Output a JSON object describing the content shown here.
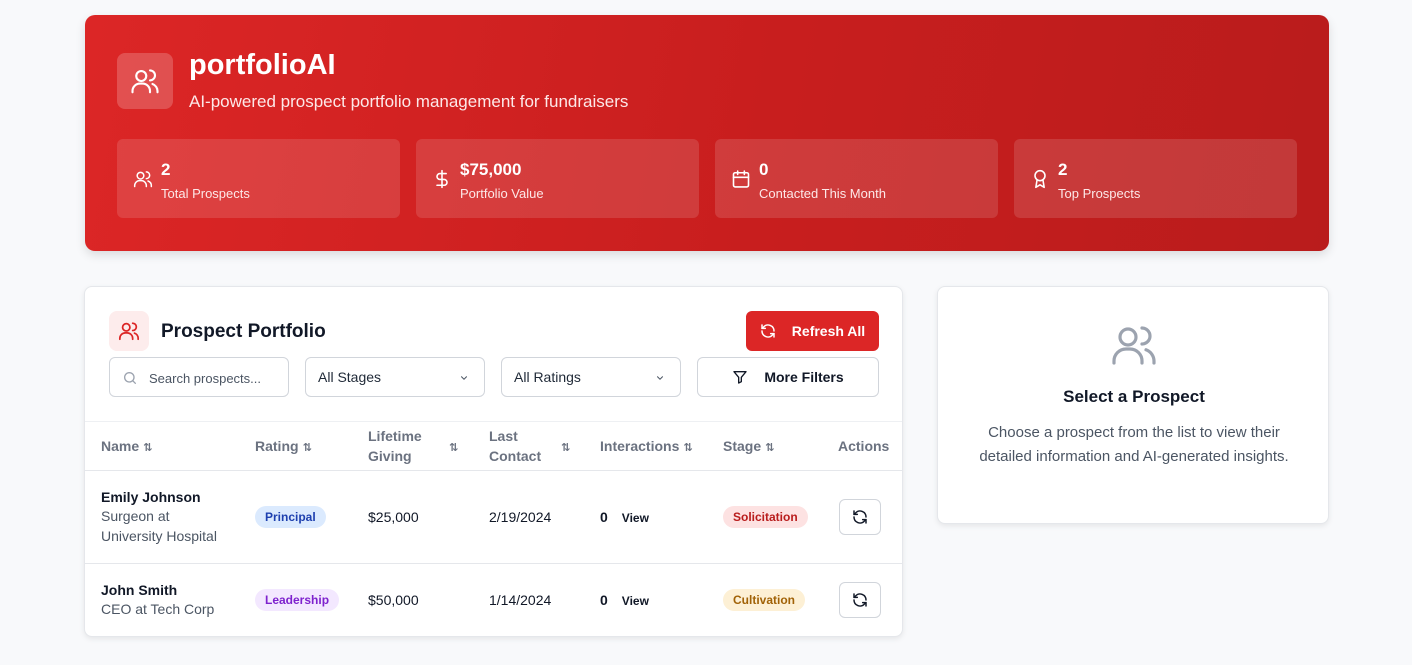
{
  "header": {
    "title": "portfolioAI",
    "subtitle": "AI-powered prospect portfolio management for fundraisers"
  },
  "stats": [
    {
      "value": "2",
      "label": "Total Prospects",
      "icon": "users-icon"
    },
    {
      "value": "$75,000",
      "label": "Portfolio Value",
      "icon": "dollar-icon"
    },
    {
      "value": "0",
      "label": "Contacted This Month",
      "icon": "calendar-icon"
    },
    {
      "value": "2",
      "label": "Top Prospects",
      "icon": "award-icon"
    }
  ],
  "portfolio": {
    "title": "Prospect Portfolio",
    "refresh_label": "Refresh All",
    "search_placeholder": "Search prospects...",
    "stage_filter": "All Stages",
    "rating_filter": "All Ratings",
    "more_filters_label": "More Filters",
    "columns": {
      "name": "Name",
      "rating": "Rating",
      "lifetime_giving": "Lifetime Giving",
      "last_contact": "Last Contact",
      "interactions": "Interactions",
      "stage": "Stage",
      "actions": "Actions"
    },
    "rows": [
      {
        "name": "Emily Johnson",
        "role": "Surgeon at University Hospital",
        "rating": "Principal",
        "giving": "$25,000",
        "last_contact": "2/19/2024",
        "interactions": "0",
        "view": "View",
        "stage": "Solicitation"
      },
      {
        "name": "John Smith",
        "role": "CEO at Tech Corp",
        "rating": "Leadership",
        "giving": "$50,000",
        "last_contact": "1/14/2024",
        "interactions": "0",
        "view": "View",
        "stage": "Cultivation"
      }
    ]
  },
  "detail": {
    "title": "Select a Prospect",
    "text": "Choose a prospect from the list to view their detailed information and AI-generated insights."
  },
  "colors": {
    "brand_red": "#dc2626",
    "principal_badge": "#dbeafe",
    "leadership_badge": "#f3e8ff",
    "solicitation_badge": "#fde2e2",
    "cultivation_badge": "#fdf0d5"
  }
}
